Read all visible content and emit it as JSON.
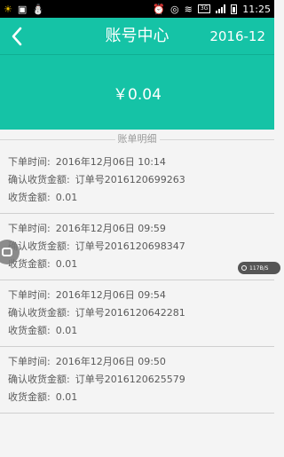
{
  "status_bar": {
    "time": "11:25",
    "network": "3G",
    "left_icons": [
      "sun-icon",
      "photo-icon",
      "android-icon"
    ],
    "right_icons": [
      "alarm-icon",
      "sound-icon",
      "wifi-icon",
      "signal-icon",
      "battery-icon"
    ]
  },
  "header": {
    "title": "账号中心",
    "month": "2016-12",
    "back_icon": "chevron-left-icon",
    "color": "#15c3a6"
  },
  "balance": {
    "amount": "￥0.04"
  },
  "bill_section": {
    "title": "账单明细"
  },
  "entries": [
    {
      "time_label": "下单时间:",
      "time_value": "2016年12月06日 10:14",
      "confirm_label": "确认收货金额:",
      "order_value": "订单号2016120699263",
      "amount_label": "收货金额:",
      "amount_value": "0.01"
    },
    {
      "time_label": "下单时间:",
      "time_value": "2016年12月06日 09:59",
      "confirm_label": "确认收货金额:",
      "order_value": "订单号2016120698347",
      "amount_label": "收货金额:",
      "amount_value": "0.01"
    },
    {
      "time_label": "下单时间:",
      "time_value": "2016年12月06日 09:54",
      "confirm_label": "确认收货金额:",
      "order_value": "订单号2016120642281",
      "amount_label": "收货金额:",
      "amount_value": "0.01"
    },
    {
      "time_label": "下单时间:",
      "time_value": "2016年12月06日 09:50",
      "confirm_label": "确认收货金额:",
      "order_value": "订单号2016120625579",
      "amount_label": "收货金额:",
      "amount_value": "0.01"
    }
  ],
  "overlay": {
    "speed": "117B/S"
  }
}
